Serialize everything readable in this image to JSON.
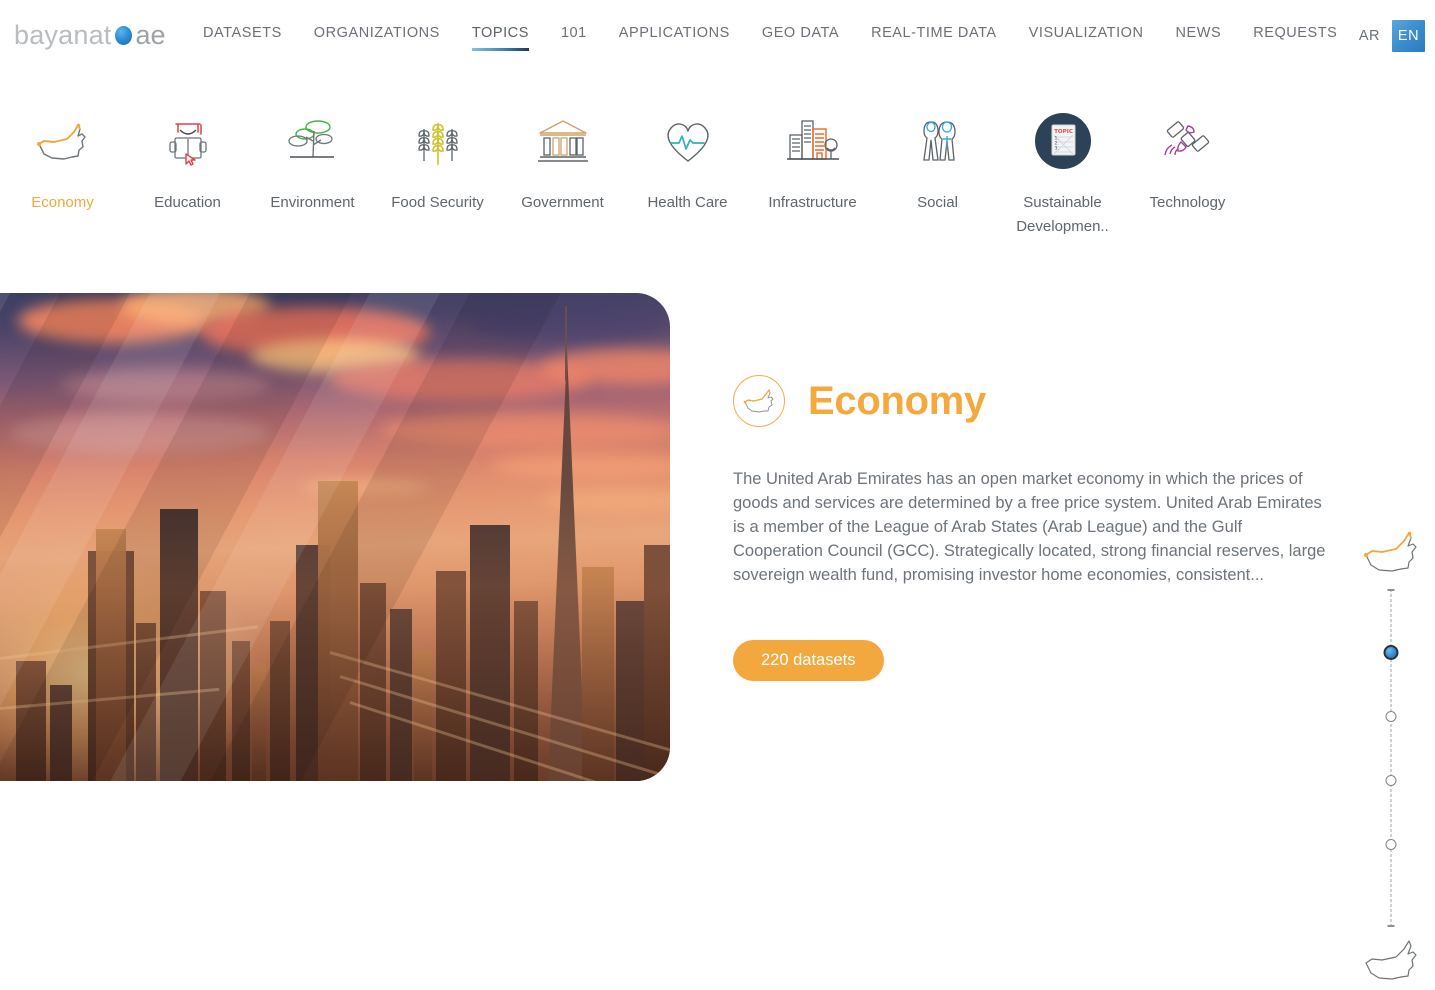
{
  "header": {
    "logo": {
      "word": "bayanat",
      "dot_icon": "blue-dot-icon",
      "suffix": "ae"
    },
    "nav": [
      {
        "label": "DATASETS",
        "active": false
      },
      {
        "label": "ORGANIZATIONS",
        "active": false
      },
      {
        "label": "TOPICS",
        "active": true
      },
      {
        "label": "101",
        "active": false
      },
      {
        "label": "APPLICATIONS",
        "active": false
      },
      {
        "label": "GEO DATA",
        "active": false
      },
      {
        "label": "REAL-TIME DATA",
        "active": false
      },
      {
        "label": "VISUALIZATION",
        "active": false
      },
      {
        "label": "NEWS",
        "active": false
      },
      {
        "label": "REQUESTS",
        "active": false
      }
    ],
    "lang": {
      "ar": "AR",
      "en": "EN",
      "active": "EN",
      "en_bg": "#3c8dcd"
    }
  },
  "topics": [
    {
      "label": "Economy",
      "icon": "uae-map-icon",
      "active": true
    },
    {
      "label": "Education",
      "icon": "graduation-book-icon",
      "active": false
    },
    {
      "label": "Environment",
      "icon": "tree-icon",
      "active": false
    },
    {
      "label": "Food Security",
      "icon": "wheat-icon",
      "active": false
    },
    {
      "label": "Government",
      "icon": "classical-building-icon",
      "active": false
    },
    {
      "label": "Health Care",
      "icon": "heart-pulse-icon",
      "active": false
    },
    {
      "label": "Infrastructure",
      "icon": "city-buildings-icon",
      "active": false
    },
    {
      "label": "Social",
      "icon": "two-people-icon",
      "active": false
    },
    {
      "label": "Sustainable Developmen..",
      "icon": "topic-document-circle-icon",
      "active": false
    },
    {
      "label": "Technology",
      "icon": "satellite-icon",
      "active": false
    }
  ],
  "hero": {
    "image_alt": "dubai-skyline-sunset",
    "badge_icon": "uae-map-circle-icon",
    "title": "Economy",
    "description": "The United Arab Emirates has an open market economy in which the prices of goods and services are determined by a free price system. United Arab Emirates is a member of the League of Arab States (Arab League) and the Gulf Cooperation Council (GCC). Strategically located, strong financial reserves, large sovereign wealth fund, promising investor home economies, consistent...",
    "cta_label": "220 datasets",
    "accent_color": "#f3a83f"
  },
  "carousel": {
    "top_icon": "uae-map-highlight-icon",
    "bottom_icon": "uae-map-outline-icon",
    "dots": [
      {
        "index": 1,
        "active": true
      },
      {
        "index": 2,
        "active": false
      },
      {
        "index": 3,
        "active": false
      },
      {
        "index": 4,
        "active": false
      }
    ]
  }
}
